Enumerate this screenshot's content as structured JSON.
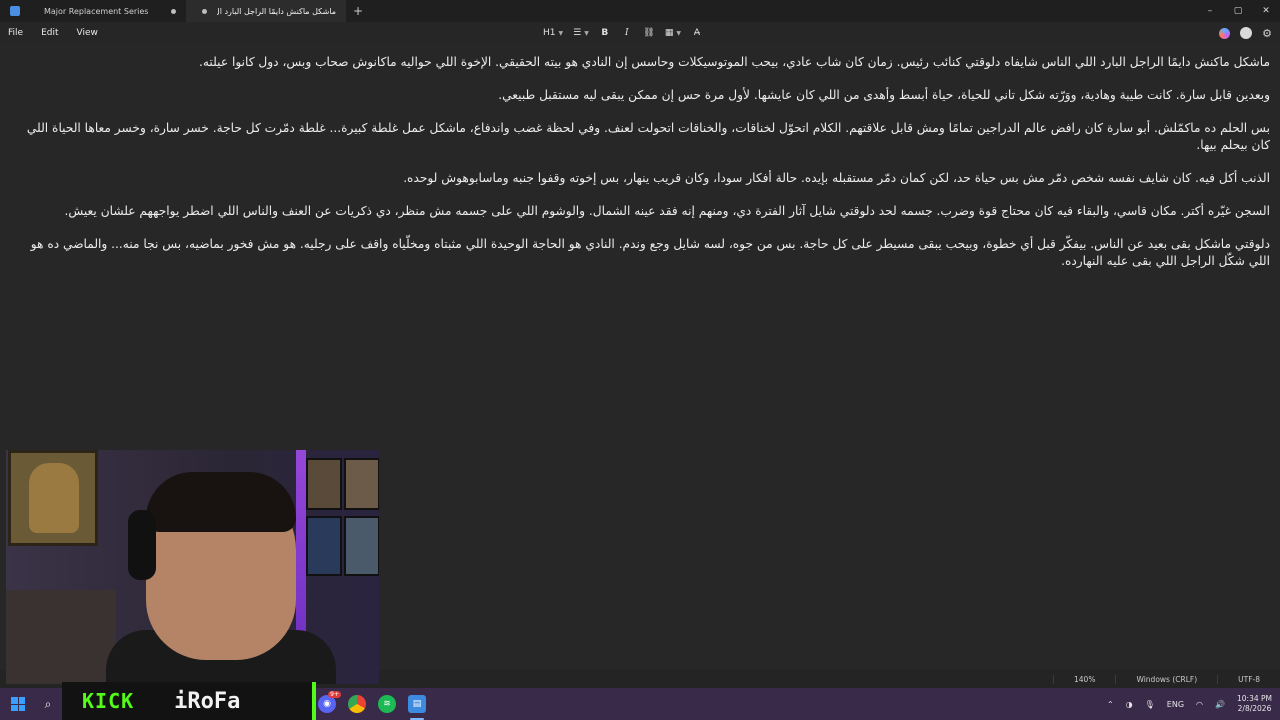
{
  "tabs": [
    {
      "label": "Major Replacement Series",
      "active": false
    },
    {
      "label": "ماشكل ماكنش دايمًا الراجل البارد ال",
      "active": true
    }
  ],
  "window_controls": {
    "minimize": "–",
    "maximize": "▢",
    "close": "✕"
  },
  "menu": [
    "File",
    "Edit",
    "View"
  ],
  "toolbar": {
    "heading": "H1",
    "list": "☰",
    "bold": "B",
    "italic": "I",
    "link": "🔗",
    "table": "▦",
    "clear": "A̶"
  },
  "document": {
    "paragraphs": [
      "ماشكل ماكنش دايمًا الراجل البارد اللي الناس شايفاه دلوقتي كنائب رئيس. زمان كان شاب عادي، بيحب الموتوسيكلات وحاسس إن النادي هو بيته الحقيقي. الإخوة اللي حواليه ماكانوش صحاب وبس، دول كانوا عيلته.",
      "وبعدين قابل سارة. كانت طيبة وهادية، ووَرّته شكل تاني للحياة، حياة أبسط وأهدى من اللي كان عايشها. لأول مرة حس إن ممكن يبقى ليه مستقبل طبيعي.",
      "بس الحلم ده ماكمّلش. أبو سارة كان رافض عالم الدراجين تمامًا ومش قابل علاقتهم. الكلام اتحوّل لخناقات، والخناقات اتحولت لعنف. وفي لحظة غضب واندفاع، ماشكل عمل غلطة كبيرة... غلطة دمّرت كل حاجة. خسر سارة، وخسر معاها الحياة اللي كان بيحلم بيها.",
      "الذنب أكل فيه. كان شايف نفسه شخص دمّر مش بس حياة حد، لكن كمان دمّر مستقبله بإيده. حالة أفكار سودا، وكان قريب ينهار، بس إخوته وقفوا جنبه وماسابوهوش لوحده.",
      "السجن غيّره أكتر. مكان قاسي، والبقاء فيه كان محتاج قوة وضرب. جسمه لحد دلوقتي شايل آثار الفترة دي، ومنهم إنه فقد عينه الشمال. والوشوم اللي على جسمه مش منظر، دي ذكريات عن العنف والناس اللي اضطر يواجههم علشان يعيش.",
      "دلوقتي ماشكل بقى بعيد عن الناس. بيفكّر قبل أي خطوة، وبيحب يبقى مسيطر على كل حاجة. بس من جوه، لسه شايل وجع وندم. النادي هو الحاجة الوحيدة اللي مثبتاه ومخلّياه واقف على رجليه. هو مش فخور بماضيه، بس نجا منه... والماضي ده هو اللي شكّل الراجل اللي بقى عليه النهارده."
    ]
  },
  "status": {
    "zoom": "140%",
    "line_endings": "Windows (CRLF)",
    "encoding": "UTF-8"
  },
  "overlay": {
    "brand_left": "KICK",
    "brand_right": "iRoFa"
  },
  "taskbar": {
    "discord_badge": "9+",
    "lang": "ENG",
    "time": "10:34 PM",
    "date": "2/8/2026"
  },
  "colors": {
    "kick_green": "#53fc18",
    "accent_blue": "#3d8be0",
    "editor_bg": "#272727"
  }
}
